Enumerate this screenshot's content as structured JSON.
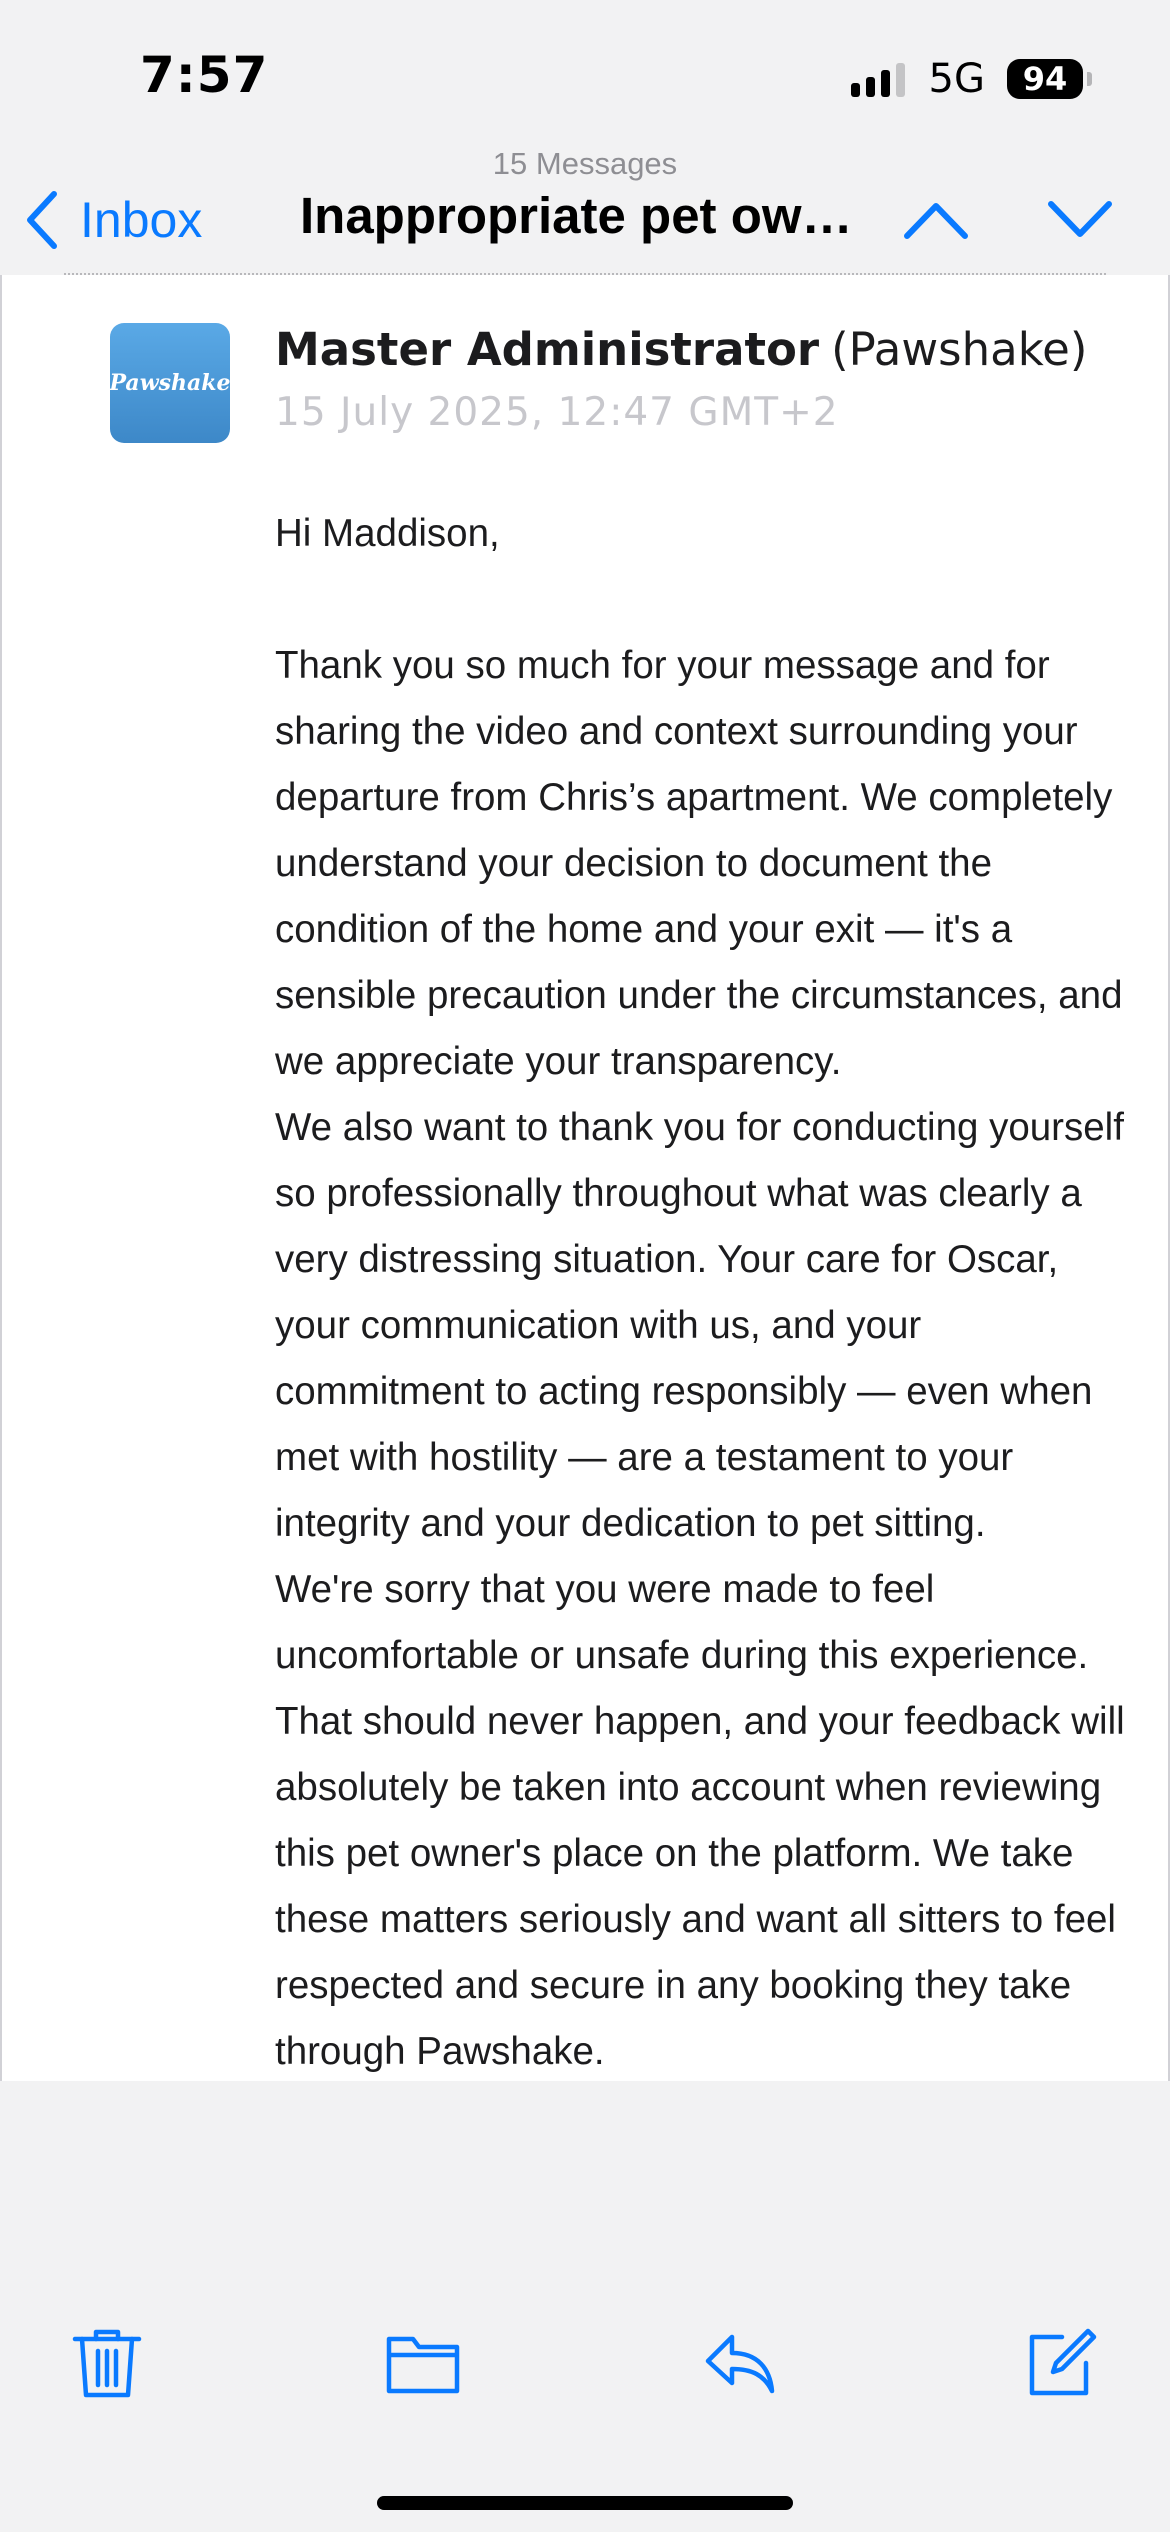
{
  "status_bar": {
    "time": "7:57",
    "network": "5G",
    "battery": "94",
    "icons": [
      "signal-bars-icon",
      "battery-icon"
    ]
  },
  "nav": {
    "message_count": "15 Messages",
    "back_label": "Inbox",
    "title": "Inappropriate pet own...",
    "icons": [
      "chevron-left-icon",
      "chevron-up-icon",
      "chevron-down-icon"
    ]
  },
  "message": {
    "avatar_text": "Pawshake",
    "sender_name": "Master Administrator",
    "sender_org": "(Pawshake)",
    "date": "15 July 2025, 12:47 GMT+2",
    "greeting": "Hi Maddison,",
    "paragraphs": [
      "Thank you so much for your message and for sharing the video and context surrounding your departure from Chris’s apartment. We completely understand your decision to document the condition of the home and your exit — it's a sensible precaution under the circumstances, and we appreciate your transparency.",
      "We also want to thank you for conducting yourself so professionally throughout what was clearly a very distressing situation. Your care for Oscar, your communication with us, and your commitment to acting responsibly — even when met with hostility — are a testament to your integrity and your dedication to pet sitting.",
      "We're sorry that you were made to feel uncomfortable or unsafe during this experience. That should never happen, and your feedback will absolutely be taken into account when reviewing this pet owner's place on the platform. We take these matters seriously and want all sitters to feel respected and secure in any booking they take through Pawshake."
    ]
  },
  "toolbar": {
    "icons": [
      "trash-icon",
      "folder-icon",
      "reply-icon",
      "compose-icon"
    ]
  },
  "colors": {
    "accent": "#0a7aff",
    "background": "#f2f2f3",
    "card": "#ffffff",
    "date_text": "#c7c7cc",
    "avatar": "#4a98d6"
  }
}
